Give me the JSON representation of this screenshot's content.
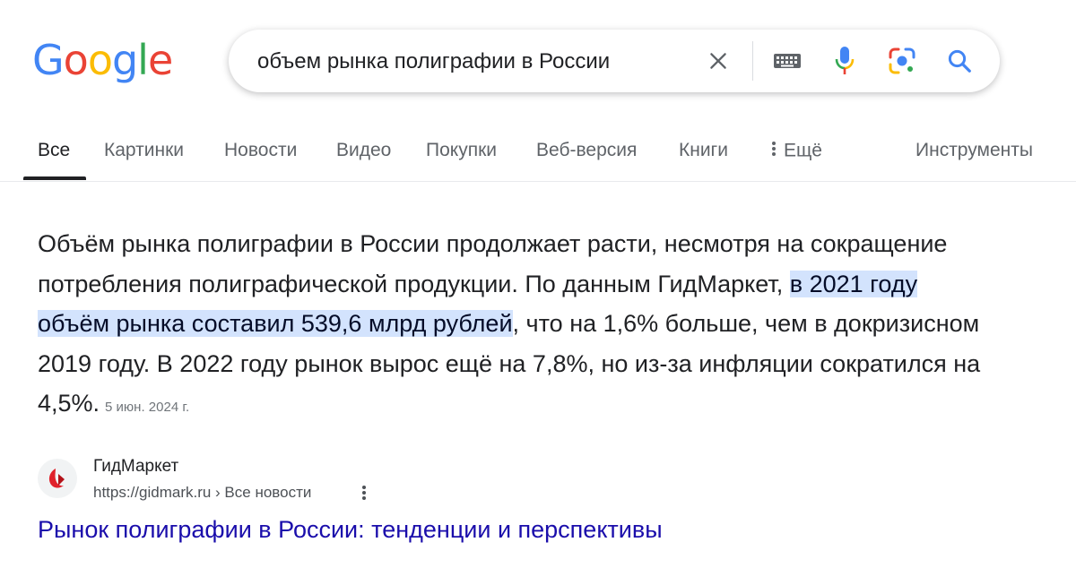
{
  "logo": {
    "letters": [
      "G",
      "o",
      "o",
      "g",
      "l",
      "e"
    ],
    "colors": [
      "#4285F4",
      "#EA4335",
      "#FBBC05",
      "#4285F4",
      "#34A853",
      "#EA4335"
    ]
  },
  "search": {
    "query": "объем рынка полиграфии в России",
    "icons": [
      "close-icon",
      "keyboard-icon",
      "microphone-icon",
      "google-lens-icon",
      "search-icon"
    ]
  },
  "tabs": [
    {
      "label": "Все",
      "active": true
    },
    {
      "label": "Картинки"
    },
    {
      "label": "Новости"
    },
    {
      "label": "Видео"
    },
    {
      "label": "Покупки"
    },
    {
      "label": "Веб-версия"
    },
    {
      "label": "Книги"
    },
    {
      "label": "Ещё",
      "icon": "more-vert-icon"
    },
    {
      "label": "Инструменты"
    }
  ],
  "snippet": {
    "text_before": "Объём рынка полиграфии в России продолжает расти, несмотря на сокращение потребления полиграфической продукции. По данным ГидМаркет, ",
    "highlight": "в 2021 году объём рынка составил 539,6 млрд рублей",
    "text_after": ", что на 1,6% больше, чем в докризисном 2019 году. В 2022 году рынок вырос ещё на 7,8%, но из-за инфляции сократился на 4,5%.",
    "date": "5 июн. 2024 г."
  },
  "result": {
    "site_name": "ГидМаркет",
    "url": "https://gidmark.ru › Все новости",
    "title": "Рынок полиграфии в России: тенденции и перспективы"
  },
  "colors": {
    "link": "#1a0dab",
    "highlight": "#d3e3fd",
    "favicon_red": "#e0212b"
  }
}
